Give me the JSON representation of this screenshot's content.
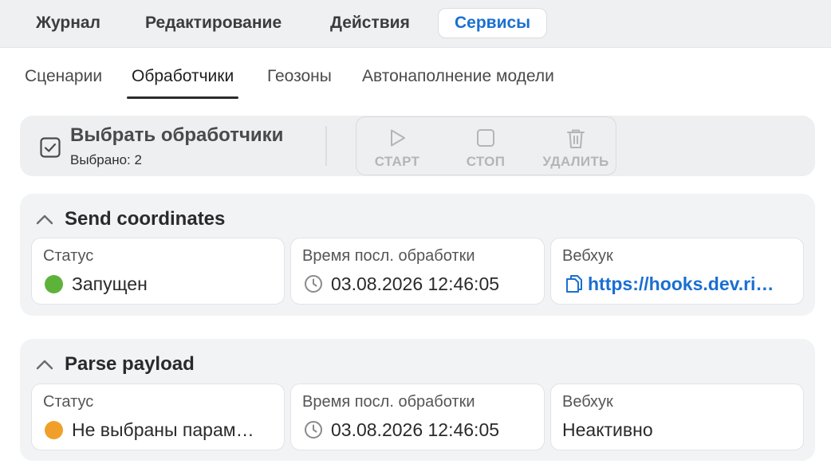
{
  "top_menu": {
    "tabs": [
      {
        "label": "Журнал"
      },
      {
        "label": "Редактирование"
      },
      {
        "label": "Действия"
      },
      {
        "label": "Сервисы"
      }
    ],
    "active_tab": "Сервисы",
    "accent_color": "#1a6fd1"
  },
  "sub_tabs": {
    "tabs": [
      {
        "label": "Сценарии"
      },
      {
        "label": "Обработчики"
      },
      {
        "label": "Геозоны"
      },
      {
        "label": "Автонаполнение модели"
      }
    ],
    "active_tab": "Обработчики"
  },
  "toolbar": {
    "select_label": "Выбрать обработчики",
    "selected_count_text": "Выбрано: 2",
    "select_icon": "checkbox-checked-icon",
    "actions": [
      {
        "label": "СТАРТ",
        "icon": "play-icon",
        "enabled": false
      },
      {
        "label": "СТОП",
        "icon": "stop-icon",
        "enabled": false
      },
      {
        "label": "УДАЛИТЬ",
        "icon": "trash-icon",
        "enabled": false
      }
    ]
  },
  "handlers": [
    {
      "name": "Send coordinates",
      "expanded": true,
      "status_label": "Статус",
      "status_value": "Запущен",
      "status_color": "#5db33a",
      "time_label": "Время посл. обработки",
      "time_value": "03.08.2026 12:46:05",
      "webhook_label": "Вебхук",
      "webhook_value": "https://hooks.dev.ri…",
      "webhook_icon": "copy-icon"
    },
    {
      "name": "Parse payload",
      "expanded": true,
      "status_label": "Статус",
      "status_value": "Не выбраны парам…",
      "status_color": "#f0a02a",
      "time_label": "Время посл. обработки",
      "time_value": "03.08.2026 12:46:05",
      "webhook_label": "Вебхук",
      "webhook_value": "Неактивно"
    }
  ]
}
